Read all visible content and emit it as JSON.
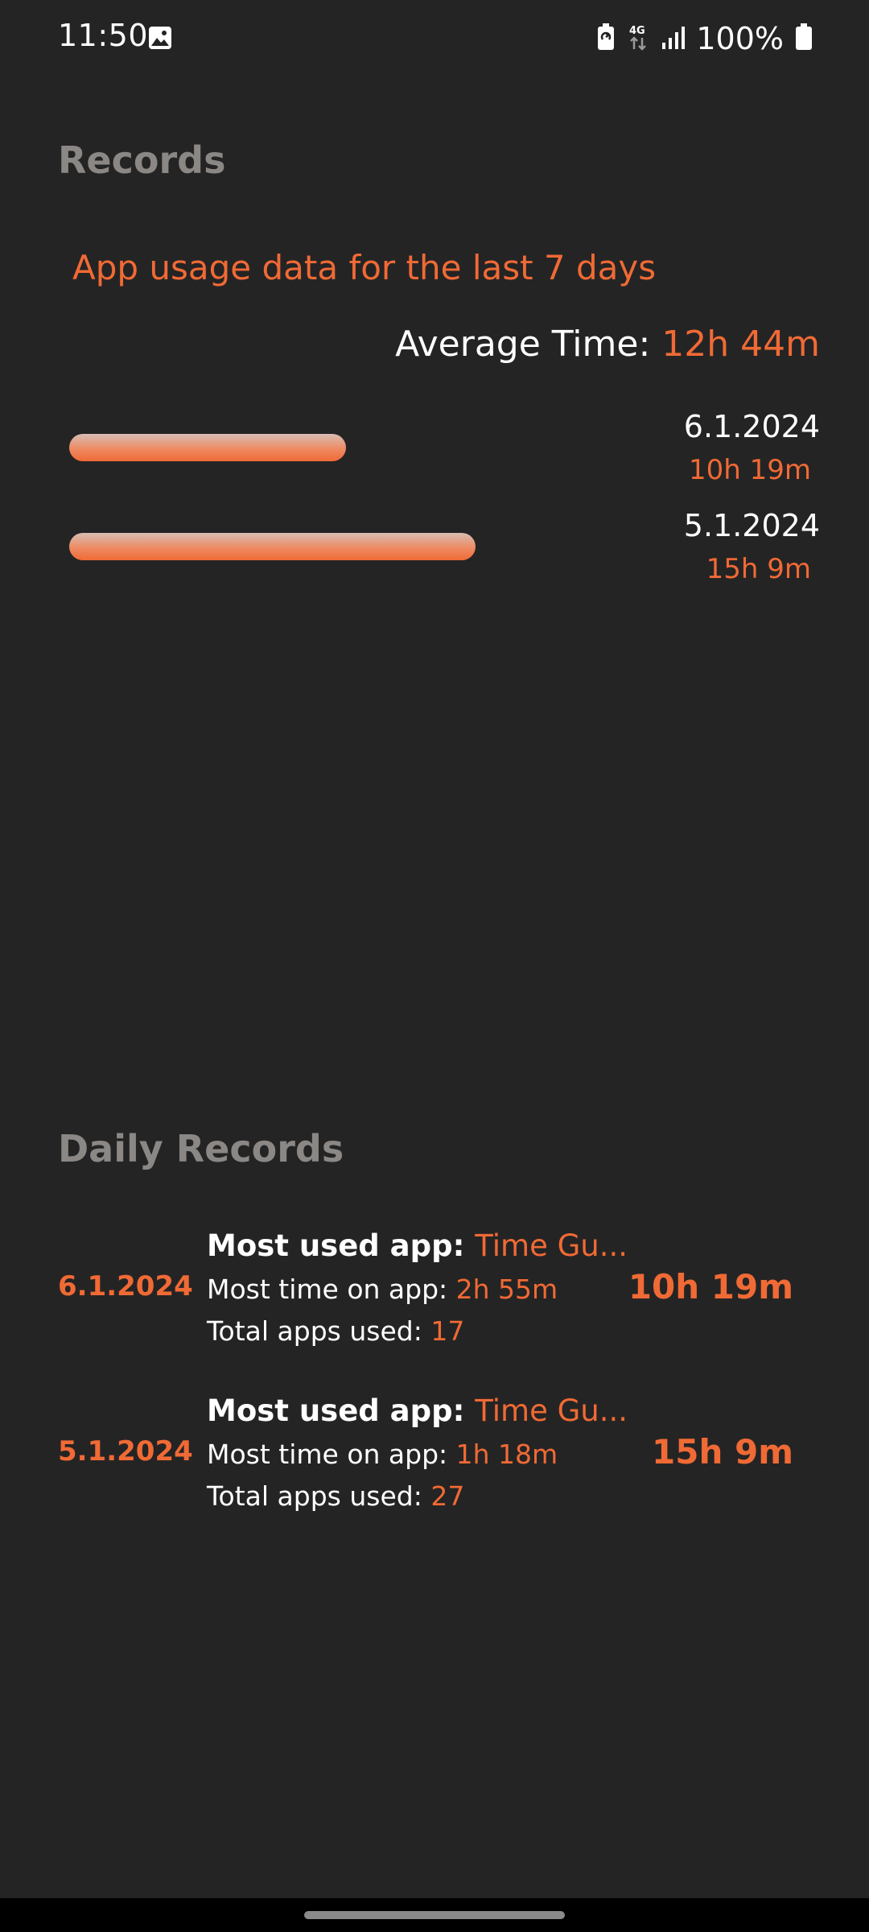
{
  "status_bar": {
    "time": "11:50",
    "battery_text": "100%",
    "network_label": "4G",
    "icons": [
      "gallery-icon",
      "battery-saver-icon",
      "network-4g-icon",
      "signal-icon",
      "battery-icon"
    ]
  },
  "records": {
    "title": "Records",
    "subtitle": "App usage data for the last 7 days",
    "average_label": "Average Time: ",
    "average_value": "12h 44m",
    "days": [
      {
        "date": "6.1.2024",
        "time": "10h 19m",
        "minutes": 619
      },
      {
        "date": "5.1.2024",
        "time": "15h 9m",
        "minutes": 909
      }
    ]
  },
  "daily_records": {
    "title": "Daily Records",
    "most_used_label": "Most used app: ",
    "most_time_label": "Most time on app: ",
    "total_apps_label": "Total apps used: ",
    "items": [
      {
        "date": "6.1.2024",
        "most_used_app": "Time Gu...",
        "most_time": "2h 55m",
        "total_apps": "17",
        "total_time": "10h 19m"
      },
      {
        "date": "5.1.2024",
        "most_used_app": "Time Gu...",
        "most_time": "1h 18m",
        "total_apps": "27",
        "total_time": "15h 9m"
      }
    ]
  },
  "colors": {
    "background": "#252424",
    "accent": "#f06a35",
    "heading": "#8a8784",
    "text": "#ffffff"
  }
}
